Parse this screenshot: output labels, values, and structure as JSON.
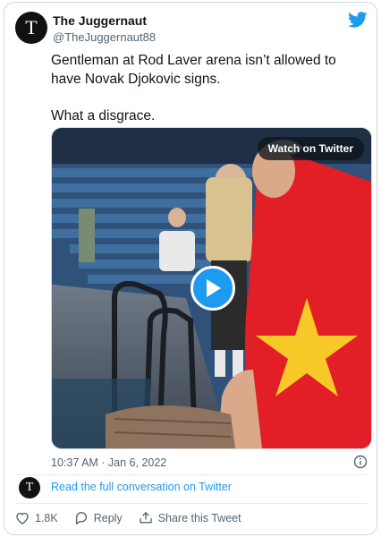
{
  "author": {
    "name": "The Juggernaut",
    "handle": "@TheJuggernaut88",
    "avatar_glyph": "T"
  },
  "tweet": {
    "text_lines": [
      "Gentleman at Rod Laver arena isn’t allowed to have Novak Djokovic signs.",
      "What a disgrace."
    ]
  },
  "media": {
    "watch_label": "Watch on Twitter"
  },
  "timestamp": "10:37 AM · Jan 6, 2022",
  "conversation": {
    "link_text": "Read the full conversation on Twitter",
    "avatar_glyph": "T"
  },
  "actions": {
    "like_count": "1.8K",
    "reply_label": "Reply",
    "share_label": "Share this Tweet"
  },
  "colors": {
    "twitter_blue": "#1d9bf0",
    "muted_text": "#536471"
  }
}
